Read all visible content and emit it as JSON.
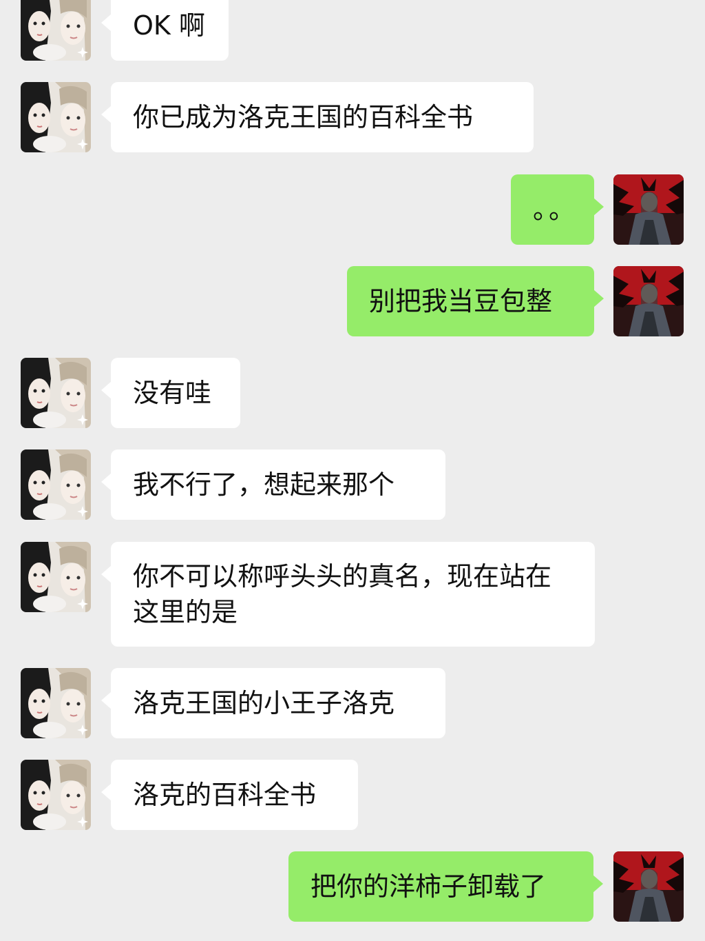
{
  "contacts": {
    "other": {
      "avatar_icon": "two-girls-avatar-icon"
    },
    "me": {
      "avatar_icon": "dark-figure-avatar-icon"
    }
  },
  "messages": [
    {
      "side": "left",
      "text": "OK 啊"
    },
    {
      "side": "left",
      "text": "你已成为洛克王国的百科全书"
    },
    {
      "side": "right",
      "text": "。。"
    },
    {
      "side": "right",
      "text": "别把我当豆包整"
    },
    {
      "side": "left",
      "text": "没有哇"
    },
    {
      "side": "left",
      "text": "我不行了，想起来那个"
    },
    {
      "side": "left",
      "text": "你不可以称呼头头的真名，现在站在这里的是"
    },
    {
      "side": "left",
      "text": "洛克王国的小王子洛克"
    },
    {
      "side": "left",
      "text": "洛克的百科全书"
    },
    {
      "side": "right",
      "text": "把你的洋柿子卸载了"
    }
  ],
  "colors": {
    "background": "#ededed",
    "incoming_bubble": "#ffffff",
    "outgoing_bubble": "#95ec69"
  }
}
